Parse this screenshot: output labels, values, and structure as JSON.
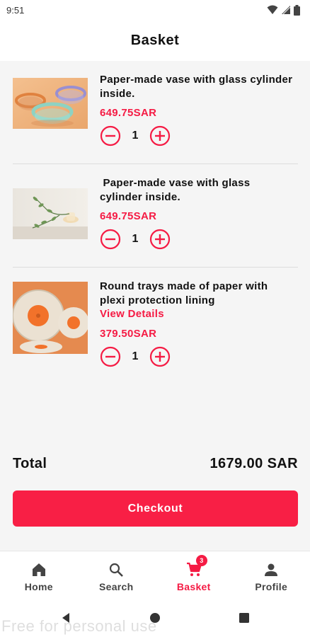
{
  "status_bar": {
    "time": "9:51",
    "icons": [
      "wifi-icon",
      "signal-icon",
      "battery-icon"
    ]
  },
  "header": {
    "title": "Basket"
  },
  "items": [
    {
      "name": "Paper-made vase with glass cylinder inside.",
      "price": "649.75SAR",
      "quantity": "1",
      "image": "glass-bowls-photo"
    },
    {
      "name": " Paper-made vase with glass cylinder inside.",
      "price": "649.75SAR",
      "quantity": "1",
      "image": "vase-branch-photo"
    },
    {
      "name": "Round trays made of paper with plexi protection lining",
      "details_link": "View Details",
      "price": "379.50SAR",
      "quantity": "1",
      "image": "paper-trays-photo"
    }
  ],
  "total": {
    "label": "Total",
    "value": "1679.00 SAR"
  },
  "checkout": {
    "label": "Checkout"
  },
  "bottom_nav": [
    {
      "label": "Home",
      "icon": "home-icon"
    },
    {
      "label": "Search",
      "icon": "search-icon"
    },
    {
      "label": "Basket",
      "icon": "cart-icon",
      "badge": "3",
      "active": true
    },
    {
      "label": "Profile",
      "icon": "person-icon"
    }
  ],
  "watermark": "Free for personal use",
  "colors": {
    "accent": "#f51b44",
    "checkout_button": "#f81f45",
    "background": "#f5f5f5"
  }
}
